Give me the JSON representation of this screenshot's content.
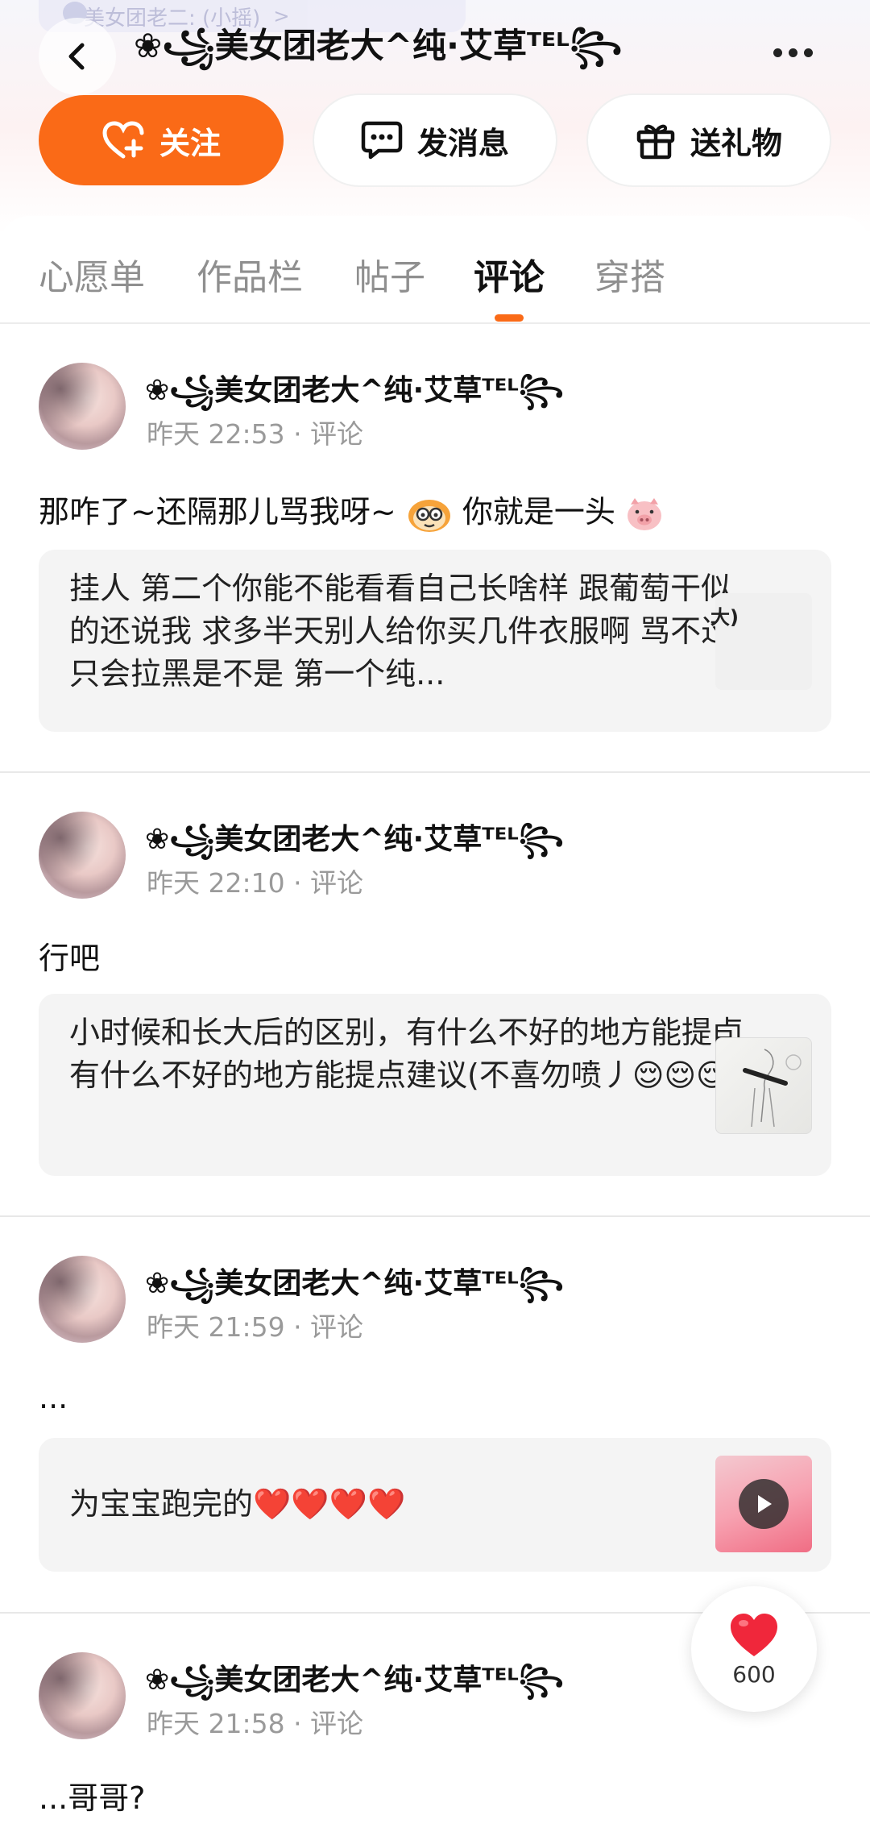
{
  "top_chip": {
    "text": "美女团老二: (小摇)",
    "arrow": ">"
  },
  "header": {
    "title": "❀꧁美女团老大^纯·艾草ᵀᴱᴸ꧂",
    "back_icon": "chevron-left-icon",
    "more_icon": "more-dots-icon"
  },
  "actions": {
    "follow_label": "关注",
    "message_label": "发消息",
    "gift_label": "送礼物"
  },
  "tabs": [
    {
      "label": "心愿单",
      "active": false
    },
    {
      "label": "作品栏",
      "active": false
    },
    {
      "label": "帖子",
      "active": false
    },
    {
      "label": "评论",
      "active": true
    },
    {
      "label": "穿搭",
      "active": false
    }
  ],
  "colors": {
    "accent": "#fa6a17",
    "like_red": "#f0273b"
  },
  "posts": [
    {
      "user": "❀꧁美女团老大^纯·艾草ᵀᴱᴸ꧂",
      "meta": "昨天 22:53 · 评论",
      "text_before": "那咋了~还隔那儿骂我呀~",
      "text_middle": "你就是一头",
      "quote": "挂人  第二个你能不能看看自己长啥样 跟葡萄干似的还说我 求多半天别人给你买几件衣服啊 骂不过只会拉黑是不是 第一个纯...",
      "thumb_text": "大)"
    },
    {
      "user": "❀꧁美女团老大^纯·艾草ᵀᴱᴸ꧂",
      "meta": "昨天 22:10 · 评论",
      "text": "行吧",
      "quote": "小时候和长大后的区别，有什么不好的地方能提卣有什么不好的地方能提点建议(不喜勿喷丿😌😌😌"
    },
    {
      "user": "❀꧁美女团老大^纯·艾草ᵀᴱᴸ꧂",
      "meta": "昨天 21:59 · 评论",
      "text": "...",
      "quote": "为宝宝跑完的❤️❤️❤️❤️"
    },
    {
      "user": "❀꧁美女团老大^纯·艾草ᵀᴱᴸ꧂",
      "meta": "昨天 21:58 · 评论",
      "text": "...哥哥?"
    }
  ],
  "like": {
    "count": "600"
  }
}
